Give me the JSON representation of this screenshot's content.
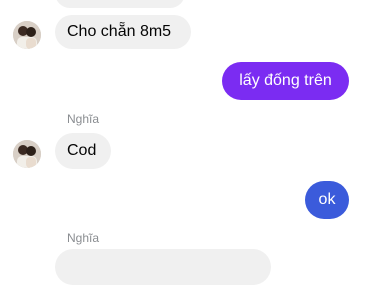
{
  "theme": {
    "outgoing_bubble": "#7b2cf2",
    "outgoing_bubble_alt": "#3b5bdb",
    "incoming_bubble": "#f0f0f0"
  },
  "messages": [
    {
      "direction": "incoming",
      "text": "Cho chẵn 8m5",
      "avatar": "avatar-couple-photo"
    },
    {
      "direction": "outgoing",
      "text": "lấy đống trên"
    },
    {
      "direction": "incoming",
      "sender": "Nghĩa",
      "text": "Cod",
      "avatar": "avatar-couple-photo"
    },
    {
      "direction": "outgoing",
      "text": "ok"
    },
    {
      "direction": "incoming",
      "sender": "Nghĩa",
      "text": ""
    }
  ]
}
